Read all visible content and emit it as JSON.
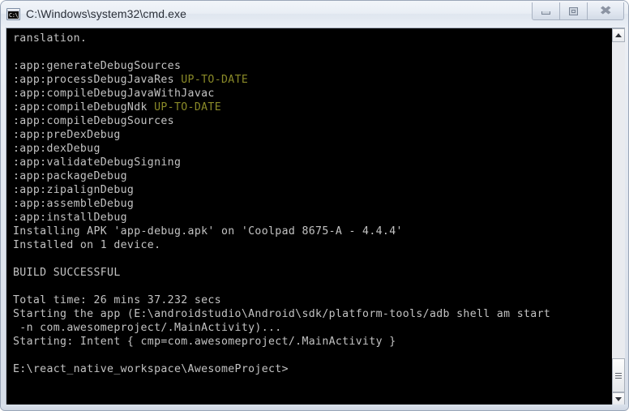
{
  "window": {
    "title": "C:\\Windows\\system32\\cmd.exe",
    "icon": "cmd-console-icon",
    "icon_text": "C:\\_",
    "controls": {
      "minimize_label": "Minimize",
      "maximize_label": "Maximize",
      "close_label": "Close",
      "close_glyph": "✖"
    }
  },
  "colors": {
    "console_background": "#000000",
    "console_foreground": "#c3c3c3",
    "up_to_date": "#8a8a28",
    "frame": "#e3e8f0"
  },
  "console": {
    "prompt": "E:\\react_native_workspace\\AwesomeProject>",
    "lines": [
      {
        "text": "ranslation."
      },
      {
        "text": ""
      },
      {
        "text": ":app:generateDebugSources"
      },
      {
        "text": ":app:processDebugJavaRes ",
        "status": "UP-TO-DATE"
      },
      {
        "text": ":app:compileDebugJavaWithJavac"
      },
      {
        "text": ":app:compileDebugNdk ",
        "status": "UP-TO-DATE"
      },
      {
        "text": ":app:compileDebugSources"
      },
      {
        "text": ":app:preDexDebug"
      },
      {
        "text": ":app:dexDebug"
      },
      {
        "text": ":app:validateDebugSigning"
      },
      {
        "text": ":app:packageDebug"
      },
      {
        "text": ":app:zipalignDebug"
      },
      {
        "text": ":app:assembleDebug"
      },
      {
        "text": ":app:installDebug"
      },
      {
        "text": "Installing APK 'app-debug.apk' on 'Coolpad 8675-A - 4.4.4'"
      },
      {
        "text": "Installed on 1 device."
      },
      {
        "text": ""
      },
      {
        "text": "BUILD SUCCESSFUL"
      },
      {
        "text": ""
      },
      {
        "text": "Total time: 26 mins 37.232 secs"
      },
      {
        "text": "Starting the app (E:\\androidstudio\\Android\\sdk/platform-tools/adb shell am start"
      },
      {
        "text": " -n com.awesomeproject/.MainActivity)..."
      },
      {
        "text": "Starting: Intent { cmp=com.awesomeproject/.MainActivity }"
      },
      {
        "text": ""
      },
      {
        "text": "E:\\react_native_workspace\\AwesomeProject>"
      }
    ]
  },
  "scrollbar": {
    "up_arrow": "scroll-up-arrow-icon",
    "down_arrow": "scroll-down-arrow-icon",
    "position": "bottom"
  }
}
